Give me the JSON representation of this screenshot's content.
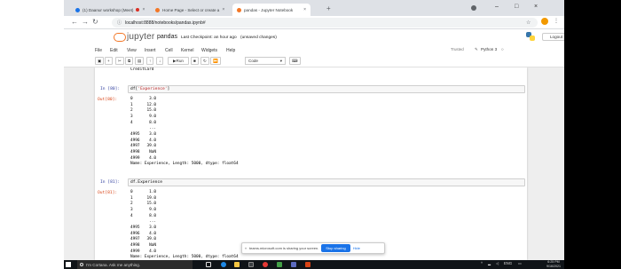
{
  "browser": {
    "tabs": [
      {
        "title": "(1) Daanur workshop (Meet)",
        "favicon_color": "#1a73e8",
        "recording": true
      },
      {
        "title": "Home Page - Select or create a",
        "favicon_color": "#f37726"
      },
      {
        "title": "pandas - Jupyter Notebook",
        "favicon_color": "#f37726",
        "active": true
      }
    ],
    "new_tab_icon": "plus-icon",
    "url_host": "localhost:8888",
    "url_path": "/notebooks/pandas.ipynb#",
    "url_display": "localhost:8888/notebooks/pandas.ipynb#"
  },
  "jupyter": {
    "logo_text": "jupyter",
    "notebook_name": "pandas",
    "checkpoint": "Last Checkpoint: an hour ago",
    "save_status": "(unsaved changes)",
    "logout_label": "Logout",
    "menu": [
      "File",
      "Edit",
      "View",
      "Insert",
      "Cell",
      "Kernel",
      "Widgets",
      "Help"
    ],
    "trusted": "Trusted",
    "kernel": "Python 3",
    "run_label": "Run",
    "cell_type": "Code"
  },
  "cells": {
    "prev_output_tail": "CreditCard",
    "cell80": {
      "in_prompt": "In [80]:",
      "code_prefix": "df[",
      "code_string": "'Experience'",
      "code_suffix": "]",
      "out_prompt": "Out[80]:",
      "output": "0       3.0\n1      12.0\n2      15.0\n3       9.0\n4       8.0\n        ...\n4995    3.0\n4996    4.0\n4997   39.0\n4998    NaN\n4999    4.0\nName: Experience, Length: 5000, dtype: float64"
    },
    "cell81": {
      "in_prompt": "In [81]:",
      "code": "df.Experience",
      "out_prompt": "Out[81]:",
      "output": "0       1.0\n1      19.0\n2      15.0\n3       9.0\n4       8.0\n        ...\n4995    3.0\n4996    4.0\n4997   39.0\n4998    NaN\n4999    4.0\nName: Experience, Length: 5000, dtype: float64"
    }
  },
  "share_bar": {
    "message": "teams.microsoft.com is sharing your screen.",
    "stop_label": "Stop sharing",
    "hide_label": "Hide"
  },
  "taskbar": {
    "search_placeholder": "I'm Cortana. Ask me anything.",
    "time": "6:25 PM",
    "date": "9/16/2021",
    "lang": "ENG"
  }
}
